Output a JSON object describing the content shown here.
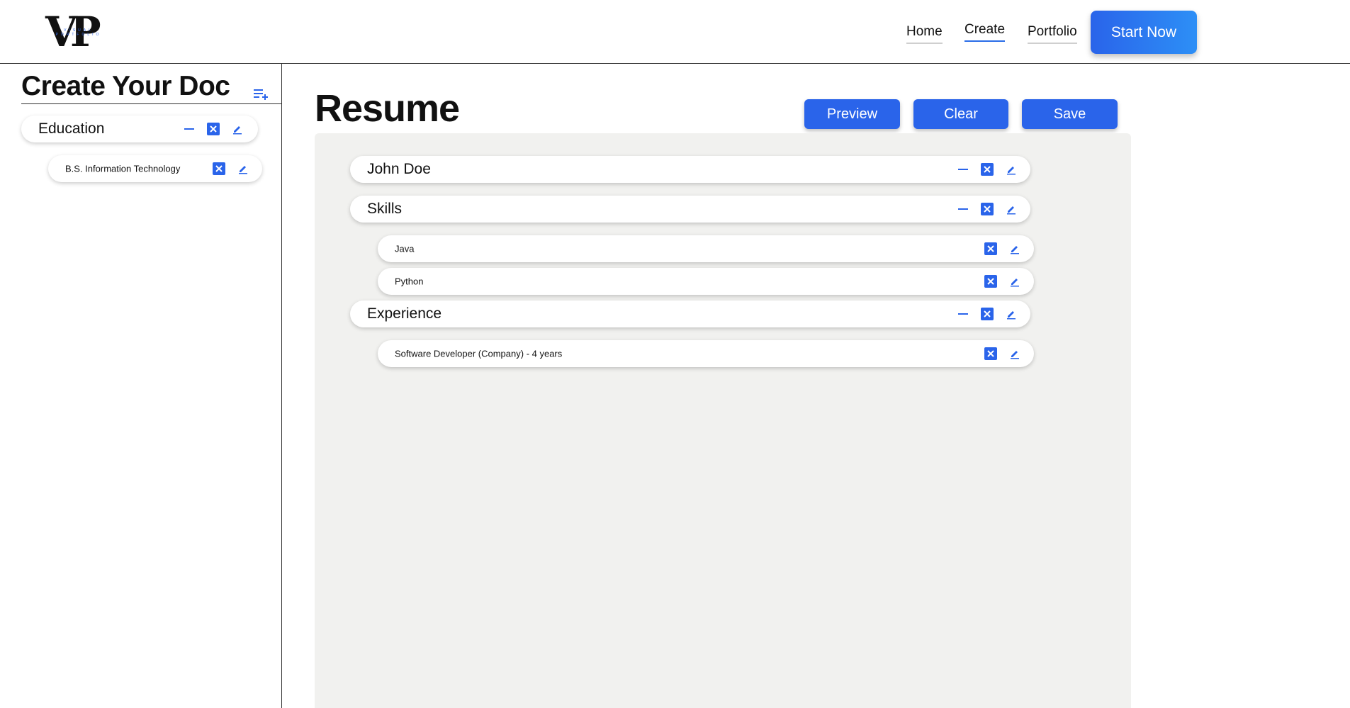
{
  "header": {
    "logo": {
      "mark": "VP",
      "tagline": "VISUAL PORTFOLIO"
    },
    "nav": [
      {
        "label": "Home",
        "active": false
      },
      {
        "label": "Create",
        "active": true
      },
      {
        "label": "Portfolio",
        "active": false
      }
    ],
    "cta_label": "Start Now"
  },
  "sidebar": {
    "title": "Create Your Doc",
    "add_icon": "playlist-add-icon",
    "sections": [
      {
        "label": "Education",
        "items": [
          {
            "label": "B.S. Information Technology"
          }
        ]
      }
    ]
  },
  "main": {
    "title": "Resume",
    "buttons": {
      "preview": "Preview",
      "clear": "Clear",
      "save": "Save"
    },
    "sections": [
      {
        "label": "John Doe",
        "items": []
      },
      {
        "label": "Skills",
        "items": [
          {
            "label": "Java"
          },
          {
            "label": "Python"
          }
        ]
      },
      {
        "label": "Experience",
        "items": [
          {
            "label": "Software Developer (Company) - 4 years"
          }
        ]
      }
    ]
  },
  "icons": {
    "collapse": "minus-icon",
    "delete": "close-square-icon",
    "edit": "pencil-icon"
  },
  "colors": {
    "accent": "#2a64ea",
    "accent_gradient_end": "#2d8ff6",
    "canvas_bg": "#f1f1ef",
    "nav_active_underline": "#2a6de8"
  }
}
